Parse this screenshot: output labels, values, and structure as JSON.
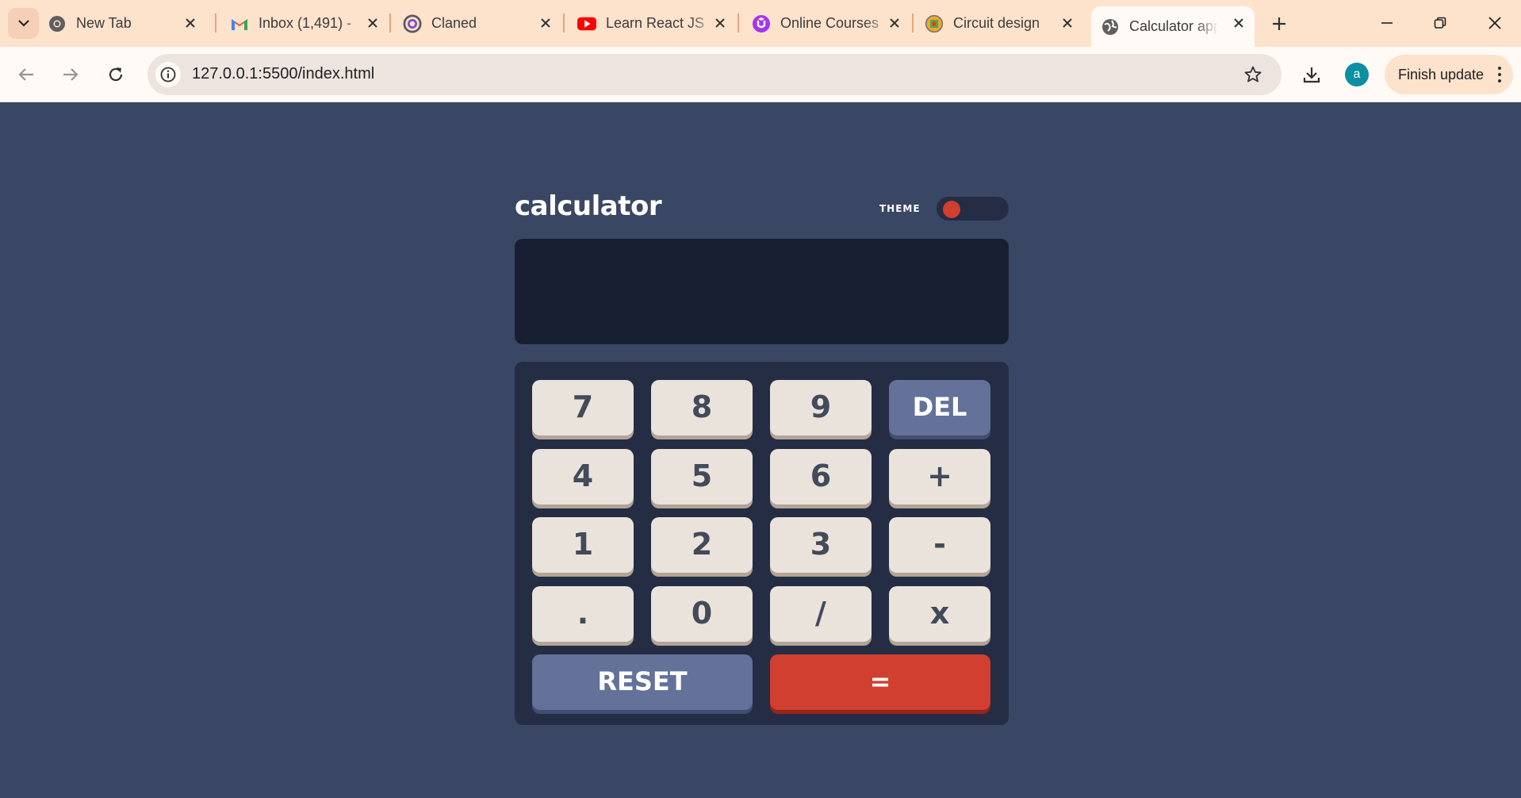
{
  "browser": {
    "tabs": [
      {
        "title": "New Tab",
        "icon": "chrome-icon",
        "active": false
      },
      {
        "title": "Inbox (1,491) -",
        "icon": "gmail-icon",
        "active": false
      },
      {
        "title": "Claned",
        "icon": "claned-icon",
        "active": false
      },
      {
        "title": "Learn React JS",
        "icon": "youtube-icon",
        "active": false
      },
      {
        "title": "Online Courses",
        "icon": "udemy-icon",
        "active": false
      },
      {
        "title": "Circuit design",
        "icon": "circuit-icon",
        "active": false
      },
      {
        "title": "Calculator app",
        "icon": "globe-icon",
        "active": true
      }
    ],
    "url": "127.0.0.1:5500/index.html",
    "profile_initial": "a",
    "update_label": "Finish update",
    "colors": {
      "tabbar": "#fde2cc",
      "toolbar": "#fffaf6",
      "omnibox": "#ede4df",
      "avatar": "#0a8fa3"
    }
  },
  "calculator": {
    "title": "calculator",
    "theme_label": "THEME",
    "display_value": "",
    "keys": {
      "k7": "7",
      "k8": "8",
      "k9": "9",
      "del": "DEL",
      "k4": "4",
      "k5": "5",
      "k6": "6",
      "plus": "+",
      "k1": "1",
      "k2": "2",
      "k3": "3",
      "minus": "-",
      "dot": ".",
      "k0": "0",
      "divide": "/",
      "multiply": "x",
      "reset": "RESET",
      "equals": "="
    },
    "colors": {
      "page_bg": "#3a4764",
      "screen_bg": "#181f33",
      "keypad_bg": "#242d44",
      "key_bg": "#eae3dc",
      "key_text": "#434a59",
      "fn_key_bg": "#647198",
      "equals_bg": "#d03f2f",
      "toggle_knob": "#d03f2f"
    }
  }
}
